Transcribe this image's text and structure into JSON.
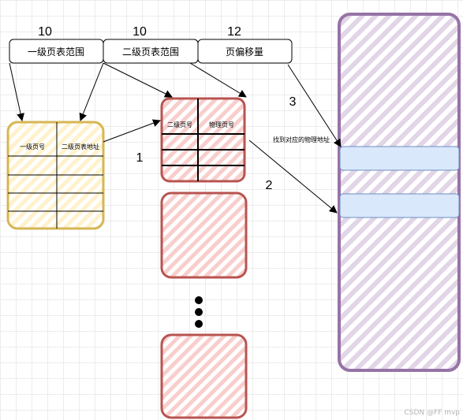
{
  "bits": {
    "level1": "10",
    "level2": "10",
    "offset": "12"
  },
  "fields": {
    "level1_range": "一级页表范围",
    "level2_range": "二级页表范围",
    "page_offset": "页偏移量"
  },
  "level1_table": {
    "col1": "一级页号",
    "col2": "二级页表地址"
  },
  "level2_table": {
    "col1": "二级页号",
    "col2": "物理页号"
  },
  "steps": {
    "s1": "1",
    "s2": "2",
    "s3": "3"
  },
  "annotation": "找到对应的物理地址",
  "watermark": "CSDN @FF mvp",
  "colors": {
    "yellow_stroke": "#d6b656",
    "yellow_fill": "#fff2cc",
    "red_stroke": "#b85450",
    "red_fill": "#f8cecc",
    "purple_stroke": "#9673a6",
    "purple_fill": "#e1d5e7",
    "blue_stroke": "#6c8ebf",
    "blue_fill": "#dae8fc"
  }
}
